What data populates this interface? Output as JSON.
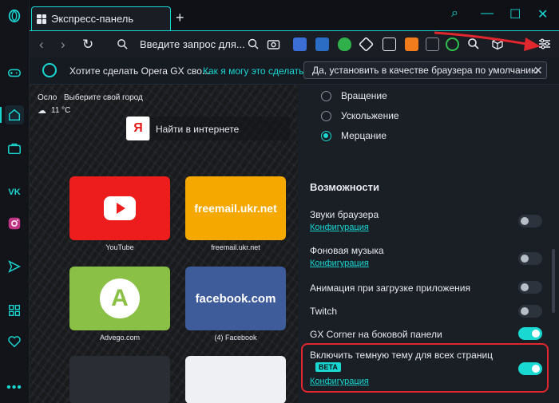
{
  "tab": {
    "title": "Экспресс-панель",
    "new_tab": "+"
  },
  "window": {
    "search": "⌕",
    "minimize": "—",
    "maximize": "☐",
    "close": "✕"
  },
  "toolbar": {
    "back": "‹",
    "forward": "›",
    "reload": "↻",
    "url_placeholder": "Введите запрос для..."
  },
  "infobar": {
    "message": "Хотите сделать Opera GX сво...",
    "link": "Как я могу это сделать?",
    "button": "Да, установить в качестве браузера по умолчанию",
    "close": "✕"
  },
  "speeddial": {
    "weather_city": "Осло",
    "weather_prompt": "Выберите свой город",
    "weather_temp": "11 °C",
    "search_placeholder": "Найти в интернете",
    "yandex_logo": "Я",
    "tiles": [
      {
        "label": "YouTube"
      },
      {
        "label": "freemail.ukr.net",
        "brand_text": "freemail.ukr.net"
      },
      {
        "label": "Advego.com",
        "brand_text": "A"
      },
      {
        "label": "(4) Facebook",
        "brand_text": "facebook.com"
      }
    ]
  },
  "settings": {
    "radios": [
      {
        "label": "Вращение",
        "selected": false
      },
      {
        "label": "Ускольжение",
        "selected": false
      },
      {
        "label": "Мерцание",
        "selected": true
      }
    ],
    "section_title": "Возможности",
    "options": [
      {
        "label": "Звуки браузера",
        "link": "Конфигурация",
        "enabled": false
      },
      {
        "label": "Фоновая музыка",
        "link": "Конфигурация",
        "enabled": false
      },
      {
        "label": "Анимация при загрузке приложения",
        "enabled": false
      },
      {
        "label": "Twitch",
        "enabled": false
      },
      {
        "label": "GX Corner на боковой панели",
        "enabled": true
      },
      {
        "label": "Включить темную тему для всех страниц",
        "badge": "BETA",
        "link": "Конфигурация",
        "enabled": true
      }
    ]
  },
  "colors": {
    "accent": "#19d8d2",
    "highlight": "#e0272e",
    "background": "#0f1116"
  }
}
